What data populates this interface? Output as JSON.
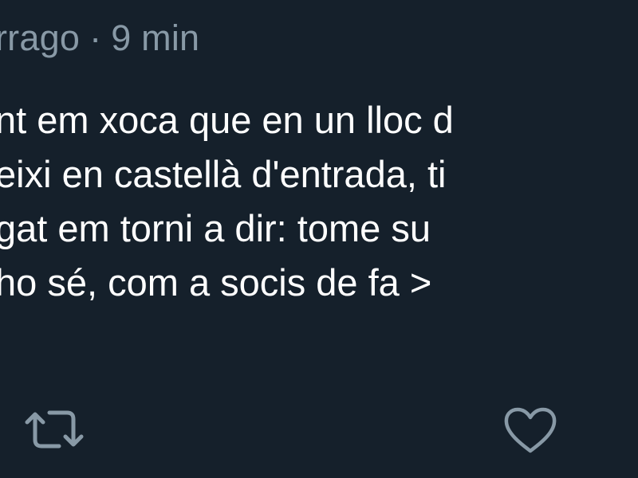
{
  "tweet": {
    "handle_fragment": "rrago",
    "separator": "·",
    "time": "9 min",
    "lines": [
      "nt em xoca que en un lloc d",
      "eixi en castellà d'entrada, ti",
      "gat em torni a dir: tome su",
      "ho sé, com a socis de fa >"
    ],
    "actions": {
      "retweet_icon": "retweet-icon",
      "like_icon": "heart-icon"
    },
    "colors": {
      "background": "#15202b",
      "secondary_text": "#8899a6",
      "primary_text": "#ffffff"
    }
  }
}
